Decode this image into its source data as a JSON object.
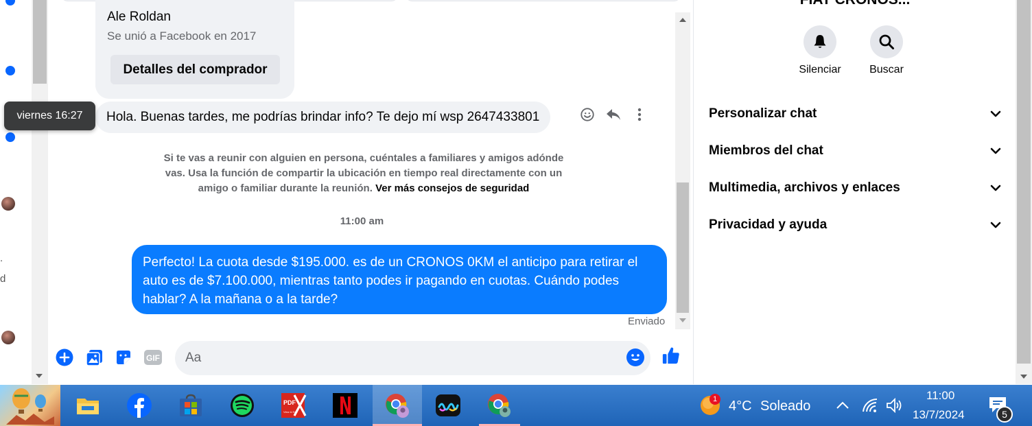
{
  "chat": {
    "buyer": {
      "name": "Ale Roldan",
      "subtitle": "Se unió a Facebook en 2017",
      "details_button": "Detalles del comprador"
    },
    "tooltip_timestamp": "viernes 16:27",
    "incoming_message": "Hola. Buenas tardes, me podrías brindar info? Te dejo mí wsp 2647433801",
    "safety_notice": "Si te vas a reunir con alguien en persona, cuéntales a familiares y amigos adónde vas. Usa la función de compartir la ubicación en tiempo real directamente con un amigo o familiar durante la reunión.",
    "safety_link": "Ver más consejos de seguridad",
    "time_separator": "11:00 am",
    "outgoing_message": "Perfecto! La cuota desde $195.000. es de un CRONOS 0KM el anticipo para retirar el auto es de $7.100.000, mientras tanto podes ir pagando en cuotas. Cuándo podes hablar? A la mañana o a la tarde?",
    "sent_status": "Enviado",
    "composer_placeholder": "Aa"
  },
  "left_sliver": {
    "text_1": ".",
    "text_2": "d"
  },
  "right_panel": {
    "title": "FIAT CRONOS...",
    "actions": [
      {
        "label": "Silenciar",
        "icon": "bell-icon"
      },
      {
        "label": "Buscar",
        "icon": "search-icon"
      }
    ],
    "sections": [
      {
        "label": "Personalizar chat"
      },
      {
        "label": "Miembros del chat"
      },
      {
        "label": "Multimedia, archivos y enlaces"
      },
      {
        "label": "Privacidad y ayuda"
      }
    ]
  },
  "taskbar": {
    "weather_badge": "1",
    "weather_temp": "4°C",
    "weather_condition": "Soleado",
    "clock_time": "11:00",
    "clock_date": "13/7/2024",
    "notification_count": "5",
    "apps": [
      "file-explorer-icon",
      "facebook-icon",
      "microsoft-store-icon",
      "spotify-icon",
      "pdf-editor-icon",
      "netflix-icon",
      "chrome-profile-icon",
      "app-icon",
      "chrome-icon"
    ]
  },
  "colors": {
    "accent": "#0a7cff",
    "messenger_blue": "#0866ff",
    "bubble_gray": "#f0f2f5"
  }
}
